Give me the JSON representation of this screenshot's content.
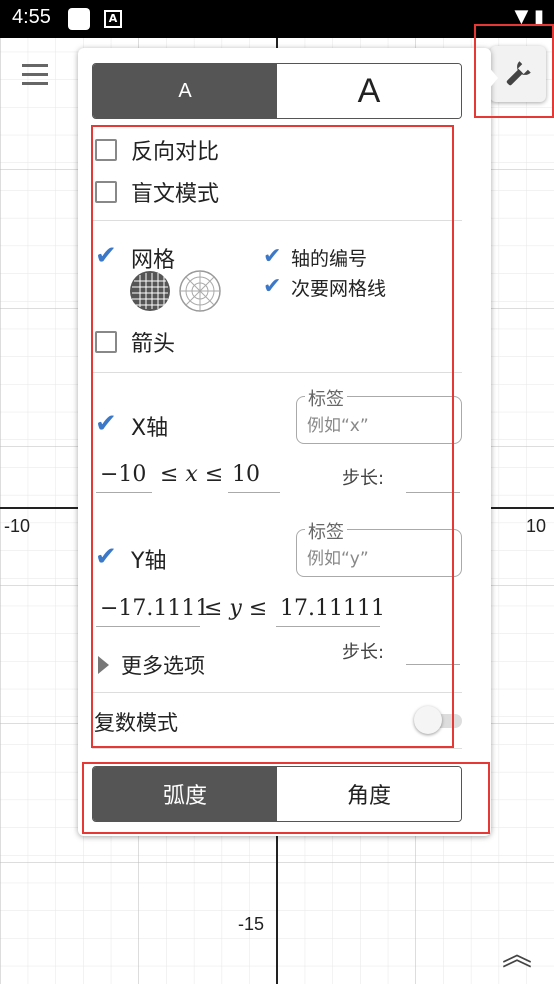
{
  "status": {
    "time": "4:55",
    "notif_icon": "A"
  },
  "graph": {
    "x_neg_label": "-10",
    "x_pos_label": "10",
    "y_neg_label": "-15"
  },
  "panel": {
    "font_size": {
      "small": "A",
      "large": "A"
    },
    "inverse_contrast": "反向对比",
    "braille_mode": "盲文模式",
    "grid": "网格",
    "axis_numbers": "轴的编号",
    "minor_gridlines": "次要网格线",
    "arrows": "箭头",
    "x_axis": {
      "label": "X轴",
      "label_title": "标签",
      "label_placeholder": "例如“x”",
      "min": "−10",
      "ineq": "≤ x ≤",
      "max": "10",
      "step_label": "步长:"
    },
    "y_axis": {
      "label": "Y轴",
      "label_title": "标签",
      "label_placeholder": "例如“y”",
      "min": "−17.1111",
      "ineq": "≤ y ≤",
      "max": "17.11111",
      "step_label": "步长:"
    },
    "more_options": "更多选项",
    "complex_mode": "复数模式",
    "angle": {
      "radians": "弧度",
      "degrees": "角度"
    }
  },
  "colors": {
    "accent": "#3c78c8",
    "highlight": "#e53935",
    "selected": "#555555"
  }
}
